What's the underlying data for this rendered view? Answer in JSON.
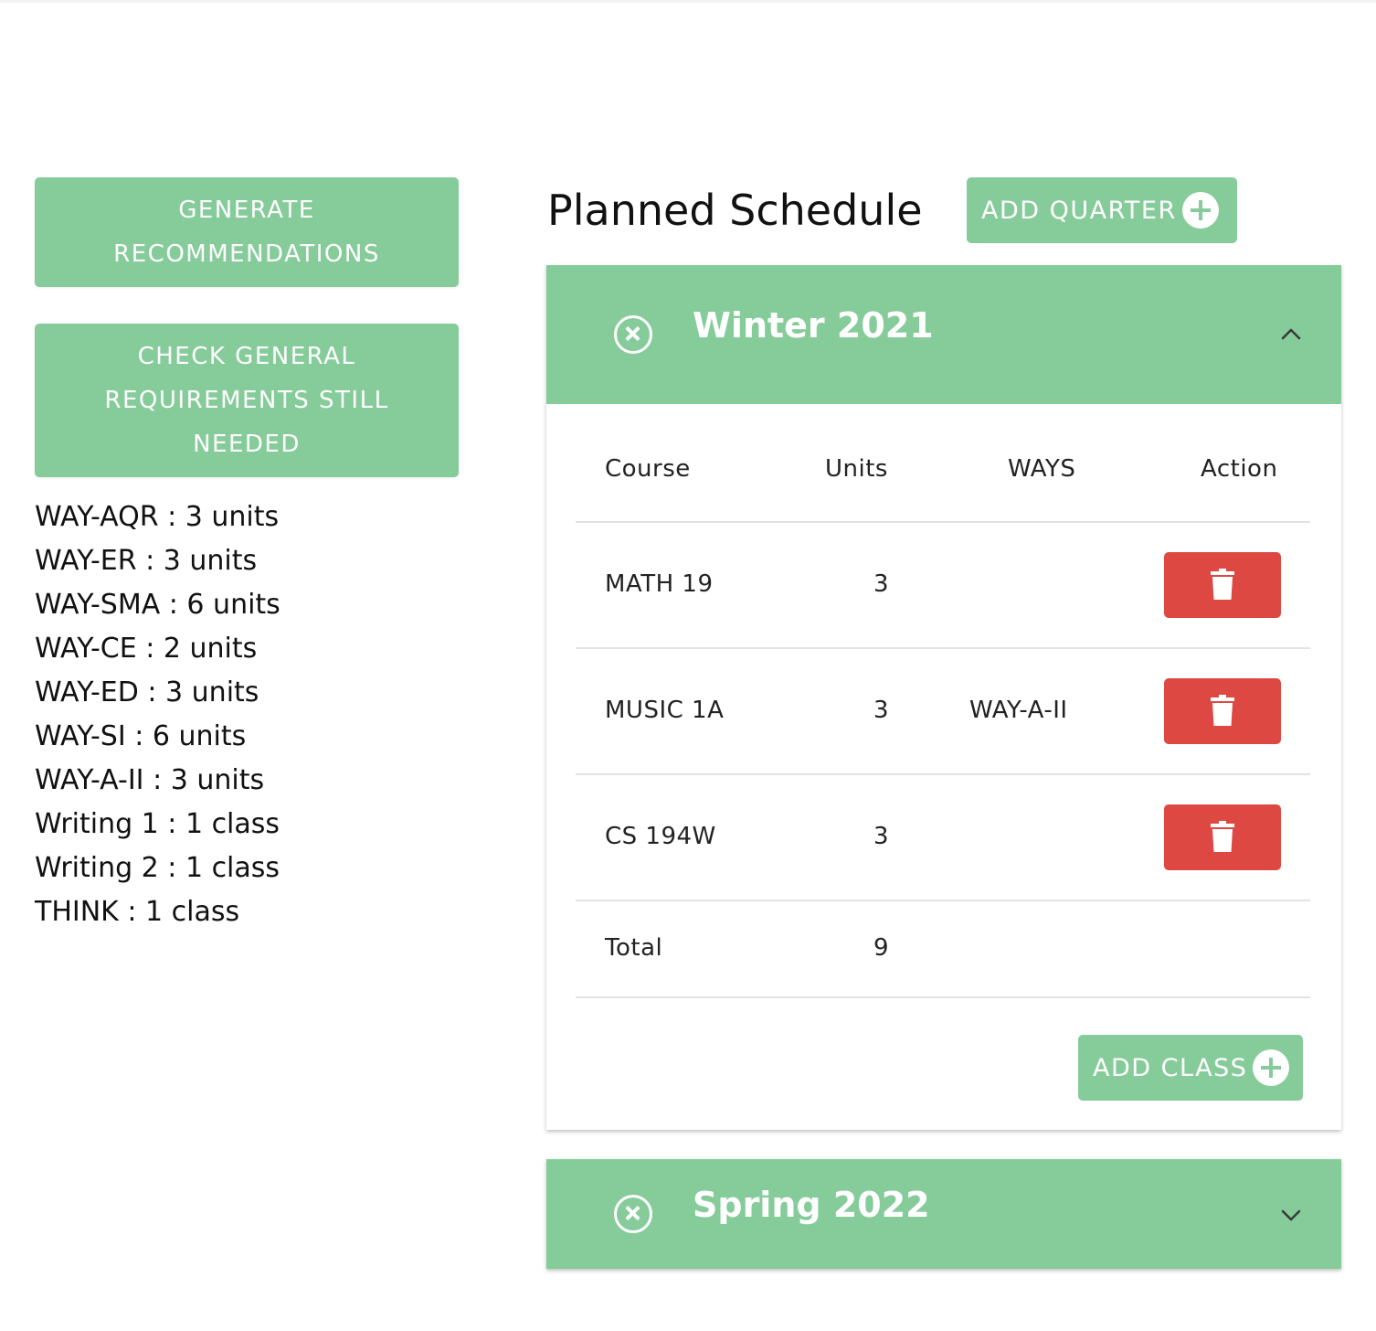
{
  "left": {
    "generate_label": "GENERATE RECOMMENDATIONS",
    "check_label": "CHECK GENERAL REQUIREMENTS STILL NEEDED",
    "requirements": [
      "WAY-AQR : 3 units",
      "WAY-ER : 3 units",
      "WAY-SMA : 6 units",
      "WAY-CE : 2 units",
      "WAY-ED : 3 units",
      "WAY-SI : 6 units",
      "WAY-A-II : 3 units",
      "Writing 1 : 1 class",
      "Writing 2 : 1 class",
      "THINK : 1 class"
    ]
  },
  "schedule": {
    "title": "Planned Schedule",
    "add_quarter_label": "ADD QUARTER",
    "quarters": [
      {
        "name": "Winter 2021",
        "expanded": true,
        "columns": [
          "Course",
          "Units",
          "WAYS",
          "Action"
        ],
        "rows": [
          {
            "course": "MATH 19",
            "units": "3",
            "ways": ""
          },
          {
            "course": "MUSIC 1A",
            "units": "3",
            "ways": "WAY-A-II"
          },
          {
            "course": "CS 194W",
            "units": "3",
            "ways": ""
          }
        ],
        "total_label": "Total",
        "total_units": "9",
        "add_class_label": "ADD CLASS"
      },
      {
        "name": "Spring 2022",
        "expanded": false
      }
    ]
  },
  "icons": {
    "remove_quarter": "close-circle-icon",
    "collapse": "chevron-up-icon",
    "expand": "chevron-down-icon",
    "delete": "trash-icon",
    "add": "plus-circle-icon"
  },
  "colors": {
    "accent": "#86cc9a",
    "danger": "#dd4843"
  }
}
